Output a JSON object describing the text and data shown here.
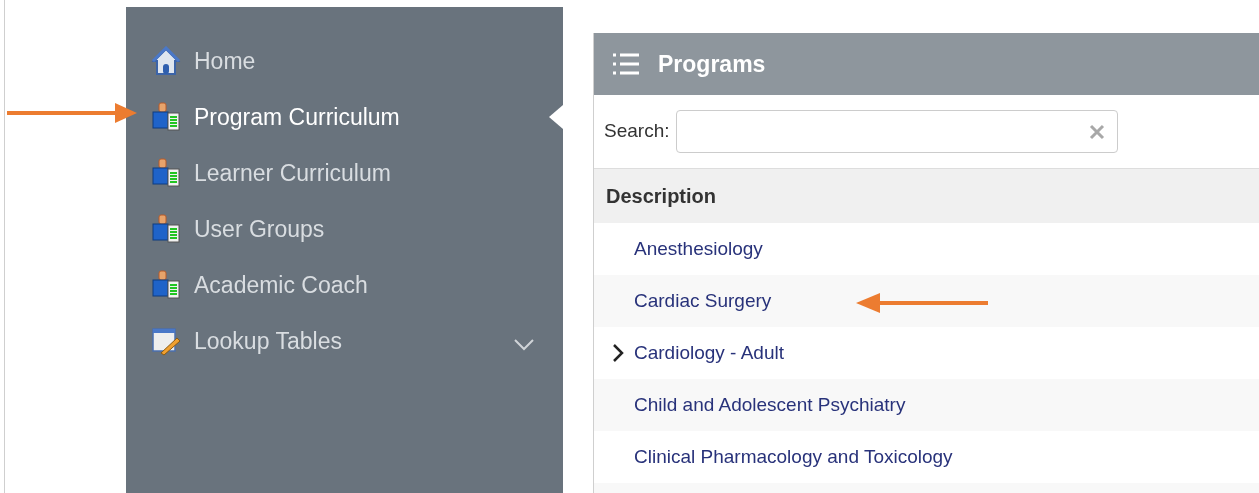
{
  "sidebar": {
    "items": [
      {
        "label": "Home",
        "kind": "home",
        "selected": false
      },
      {
        "label": "Program Curriculum",
        "kind": "curriculum",
        "selected": true
      },
      {
        "label": "Learner Curriculum",
        "kind": "curriculum",
        "selected": false
      },
      {
        "label": "User Groups",
        "kind": "curriculum",
        "selected": false
      },
      {
        "label": "Academic Coach",
        "kind": "curriculum",
        "selected": false
      },
      {
        "label": "Lookup Tables",
        "kind": "lookup",
        "selected": false,
        "expanded": false
      }
    ]
  },
  "panel": {
    "title": "Programs",
    "search": {
      "label": "Search:"
    },
    "table": {
      "columns": [
        "Description"
      ],
      "rows": [
        {
          "description": "Anesthesiology",
          "expandable": false
        },
        {
          "description": "Cardiac Surgery",
          "expandable": false
        },
        {
          "description": "Cardiology - Adult",
          "expandable": true
        },
        {
          "description": "Child and Adolescent Psychiatry",
          "expandable": false
        },
        {
          "description": "Clinical Pharmacology and Toxicology",
          "expandable": false
        }
      ]
    }
  }
}
